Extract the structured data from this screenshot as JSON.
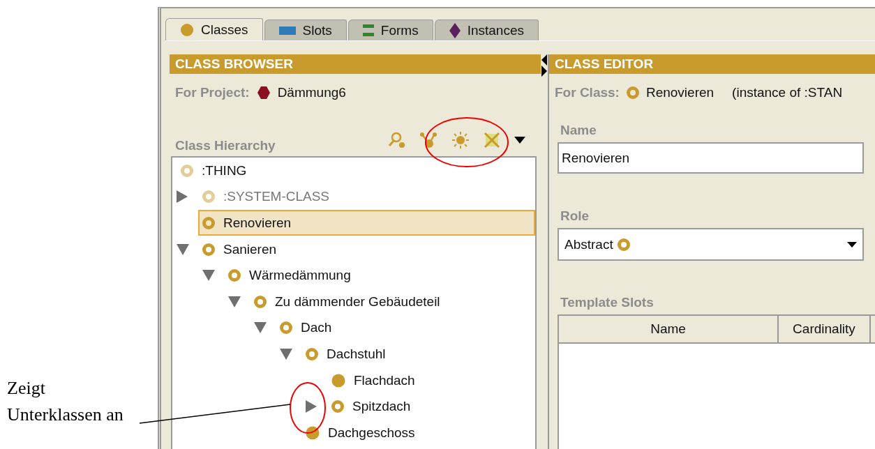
{
  "annotation": {
    "text": "Zeigt Unterklassen an"
  },
  "tabs": [
    {
      "label": "Classes",
      "kind": "classes",
      "selected": true
    },
    {
      "label": "Slots",
      "kind": "slots",
      "selected": false
    },
    {
      "label": "Forms",
      "kind": "forms",
      "selected": false
    },
    {
      "label": "Instances",
      "kind": "instances",
      "selected": false
    }
  ],
  "class_browser": {
    "title": "CLASS BROWSER",
    "project_label": "For Project:",
    "project_name": "Dämmung6",
    "hierarchy_label": "Class Hierarchy",
    "tree": [
      {
        "label": ":THING",
        "kind": "system",
        "dimmed": false,
        "selected": false,
        "children": [
          {
            "label": ":SYSTEM-CLASS",
            "kind": "system",
            "dimmed": true,
            "selected": false,
            "expanded": false
          },
          {
            "label": "Renovieren",
            "kind": "abstract",
            "dimmed": false,
            "selected": true
          },
          {
            "label": "Sanieren",
            "kind": "abstract",
            "dimmed": false,
            "selected": false,
            "expanded": true,
            "children": [
              {
                "label": "Wärmedämmung",
                "kind": "abstract",
                "dimmed": false,
                "selected": false,
                "expanded": true,
                "children": [
                  {
                    "label": "Zu dämmender Gebäudeteil",
                    "kind": "abstract",
                    "dimmed": false,
                    "selected": false,
                    "expanded": true,
                    "children": [
                      {
                        "label": "Dach",
                        "kind": "abstract",
                        "dimmed": false,
                        "selected": false,
                        "expanded": true,
                        "children": [
                          {
                            "label": "Dachstuhl",
                            "kind": "abstract",
                            "dimmed": false,
                            "selected": false,
                            "expanded": true,
                            "children": [
                              {
                                "label": "Flachdach",
                                "kind": "concrete",
                                "dimmed": false,
                                "selected": false
                              },
                              {
                                "label": "Spitzdach",
                                "kind": "abstract",
                                "dimmed": false,
                                "selected": false,
                                "expanded": false
                              }
                            ]
                          },
                          {
                            "label": "Dachgeschoss",
                            "kind": "concrete",
                            "dimmed": false,
                            "selected": false
                          }
                        ]
                      }
                    ]
                  }
                ]
              }
            ]
          }
        ]
      }
    ]
  },
  "class_editor": {
    "title": "CLASS EDITOR",
    "class_label": "For Class:",
    "class_name": "Renovieren",
    "instance_of": "(instance of :STAN",
    "name_label": "Name",
    "name_value": "Renovieren",
    "role_label": "Role",
    "role_value": "Abstract",
    "template_label": "Template Slots",
    "columns": [
      "Name",
      "Cardinality"
    ]
  }
}
